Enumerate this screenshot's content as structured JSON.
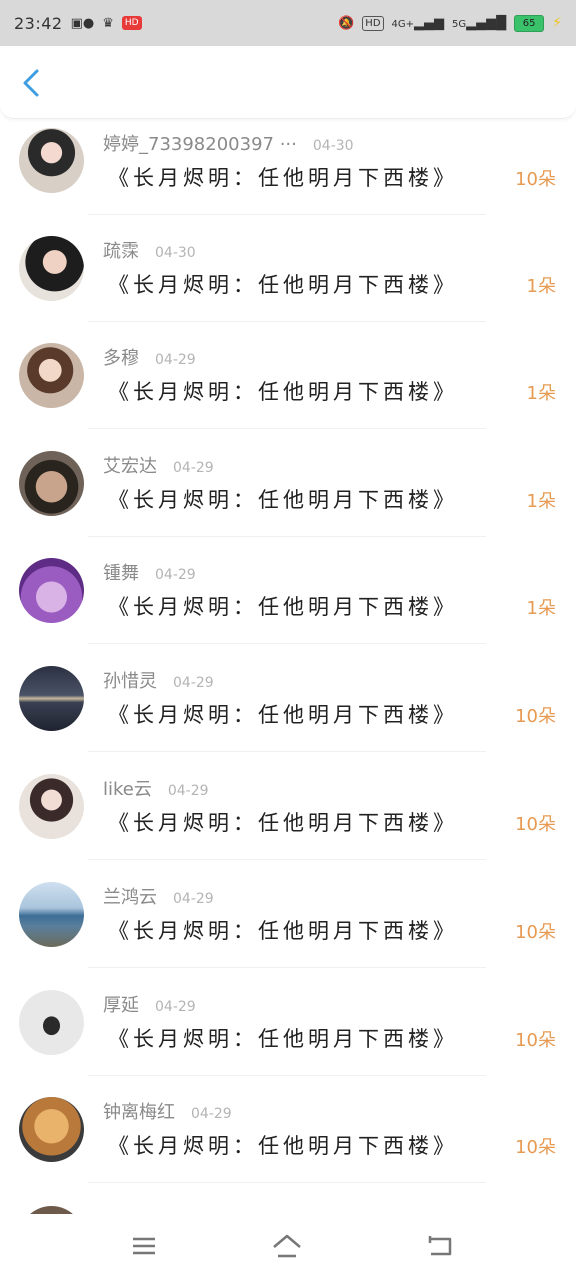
{
  "status_bar": {
    "time": "23:42",
    "hd_label": "HD",
    "network_4g": "4G+",
    "network_5g": "5G",
    "battery": "65",
    "app_badge": "HD"
  },
  "list": [
    {
      "name": "婷婷_73398200397 ···",
      "date": "04-30",
      "message": "《长月烬明：任他明月下西楼》",
      "count": "10朵"
    },
    {
      "name": "疏霂",
      "date": "04-30",
      "message": "《长月烬明：任他明月下西楼》",
      "count": "1朵"
    },
    {
      "name": "多穆",
      "date": "04-29",
      "message": "《长月烬明：任他明月下西楼》",
      "count": "1朵"
    },
    {
      "name": "艾宏达",
      "date": "04-29",
      "message": "《长月烬明：任他明月下西楼》",
      "count": "1朵"
    },
    {
      "name": "锺舞",
      "date": "04-29",
      "message": "《长月烬明：任他明月下西楼》",
      "count": "1朵"
    },
    {
      "name": "孙惜灵",
      "date": "04-29",
      "message": "《长月烬明：任他明月下西楼》",
      "count": "10朵"
    },
    {
      "name": "like云",
      "date": "04-29",
      "message": "《长月烬明：任他明月下西楼》",
      "count": "10朵"
    },
    {
      "name": "兰鸿云",
      "date": "04-29",
      "message": "《长月烬明：任他明月下西楼》",
      "count": "10朵"
    },
    {
      "name": "厚延",
      "date": "04-29",
      "message": "《长月烬明：任他明月下西楼》",
      "count": "10朵"
    },
    {
      "name": "钟离梅红",
      "date": "04-29",
      "message": "《长月烬明：任他明月下西楼》",
      "count": "10朵"
    }
  ],
  "colors": {
    "accent_back": "#3f9ee2",
    "count_orange": "#e79a52"
  },
  "icons": {
    "back": "chevron-left-icon",
    "menu": "menu-icon",
    "home": "home-icon",
    "return": "return-icon"
  }
}
